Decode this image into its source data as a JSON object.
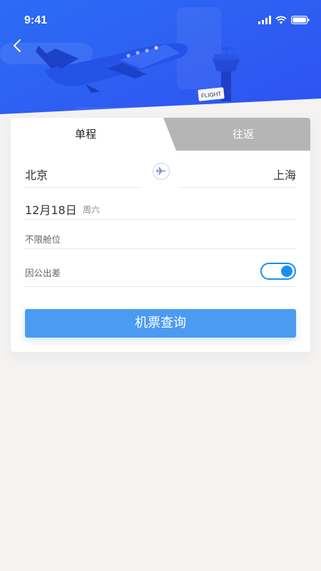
{
  "status_bar": {
    "time": "9:41"
  },
  "hero": {
    "tower_sign": "FLIGHT"
  },
  "tabs": {
    "one_way": "单程",
    "round_trip": "往返"
  },
  "route": {
    "from_city": "北京",
    "to_city": "上海"
  },
  "date": {
    "value": "12月18日",
    "weekday": "周六"
  },
  "cabin": {
    "label": "不限舱位"
  },
  "business_trip": {
    "label": "因公出差",
    "enabled": true
  },
  "search": {
    "label": "机票查询"
  },
  "colors": {
    "primary": "#4b9bf2",
    "hero": "#2f5bf2",
    "toggle": "#1a8ff0"
  }
}
